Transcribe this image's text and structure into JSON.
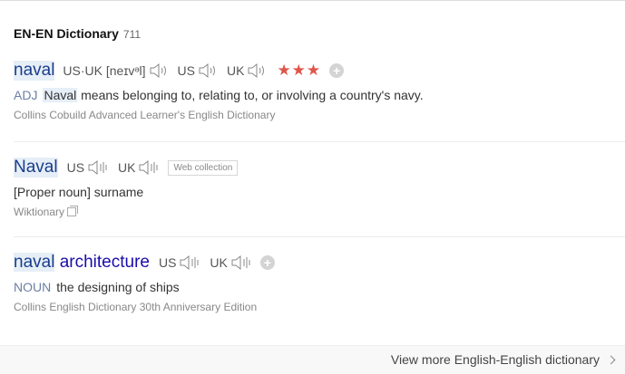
{
  "header": {
    "title": "EN-EN Dictionary",
    "count": "711"
  },
  "entries": [
    {
      "headword": "naval",
      "us_uk_label": "US·UK",
      "ipa": "[neɪvᵊl]",
      "us_label": "US",
      "uk_label": "UK",
      "stars": "★★★",
      "pos": "ADJ",
      "def_highlight": "Naval",
      "def_rest": " means belonging to, relating to, or involving a country's navy.",
      "source": "Collins Cobuild Advanced Learner's English Dictionary"
    },
    {
      "headword": "Naval",
      "us_label": "US",
      "uk_label": "UK",
      "tag": "Web collection",
      "definition": "[Proper noun] surname",
      "source": "Wiktionary"
    },
    {
      "headword_highlight": "naval",
      "headword_rest": " architecture",
      "us_label": "US",
      "uk_label": "UK",
      "pos": "NOUN",
      "definition": "the designing of ships",
      "source": "Collins English Dictionary 30th Anniversary Edition"
    }
  ],
  "footer": {
    "more_label": "View more English-English dictionary"
  },
  "colors": {
    "link": "#1a0dab",
    "highlight_bg": "#e6eef7",
    "stars": "#e0554a",
    "pos": "#6b7fa5"
  },
  "icons": [
    "speaker-icon",
    "sound-wave-icon",
    "plus-icon",
    "copy-icon",
    "chevron-right-icon"
  ]
}
